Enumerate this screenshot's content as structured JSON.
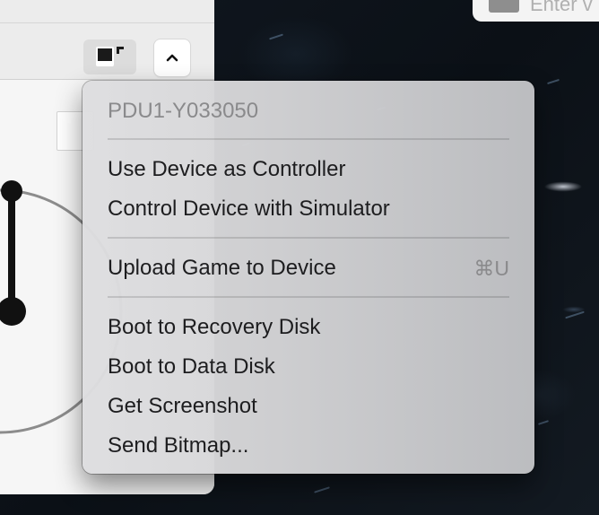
{
  "menu": {
    "header": "PDU1-Y033050",
    "items": [
      {
        "label": "Use Device as Controller"
      },
      {
        "label": "Control Device with Simulator"
      },
      {
        "label": "Upload Game to Device",
        "shortcut": "⌘U"
      },
      {
        "label": "Boot to Recovery Disk"
      },
      {
        "label": "Boot to Data Disk"
      },
      {
        "label": "Get Screenshot"
      },
      {
        "label": "Send Bitmap..."
      }
    ]
  },
  "background_field": {
    "placeholder": "Enter v"
  },
  "toolbar": {
    "layout_button_icon": "window-layout-icon",
    "chevron_button_icon": "chevron-up-icon"
  }
}
